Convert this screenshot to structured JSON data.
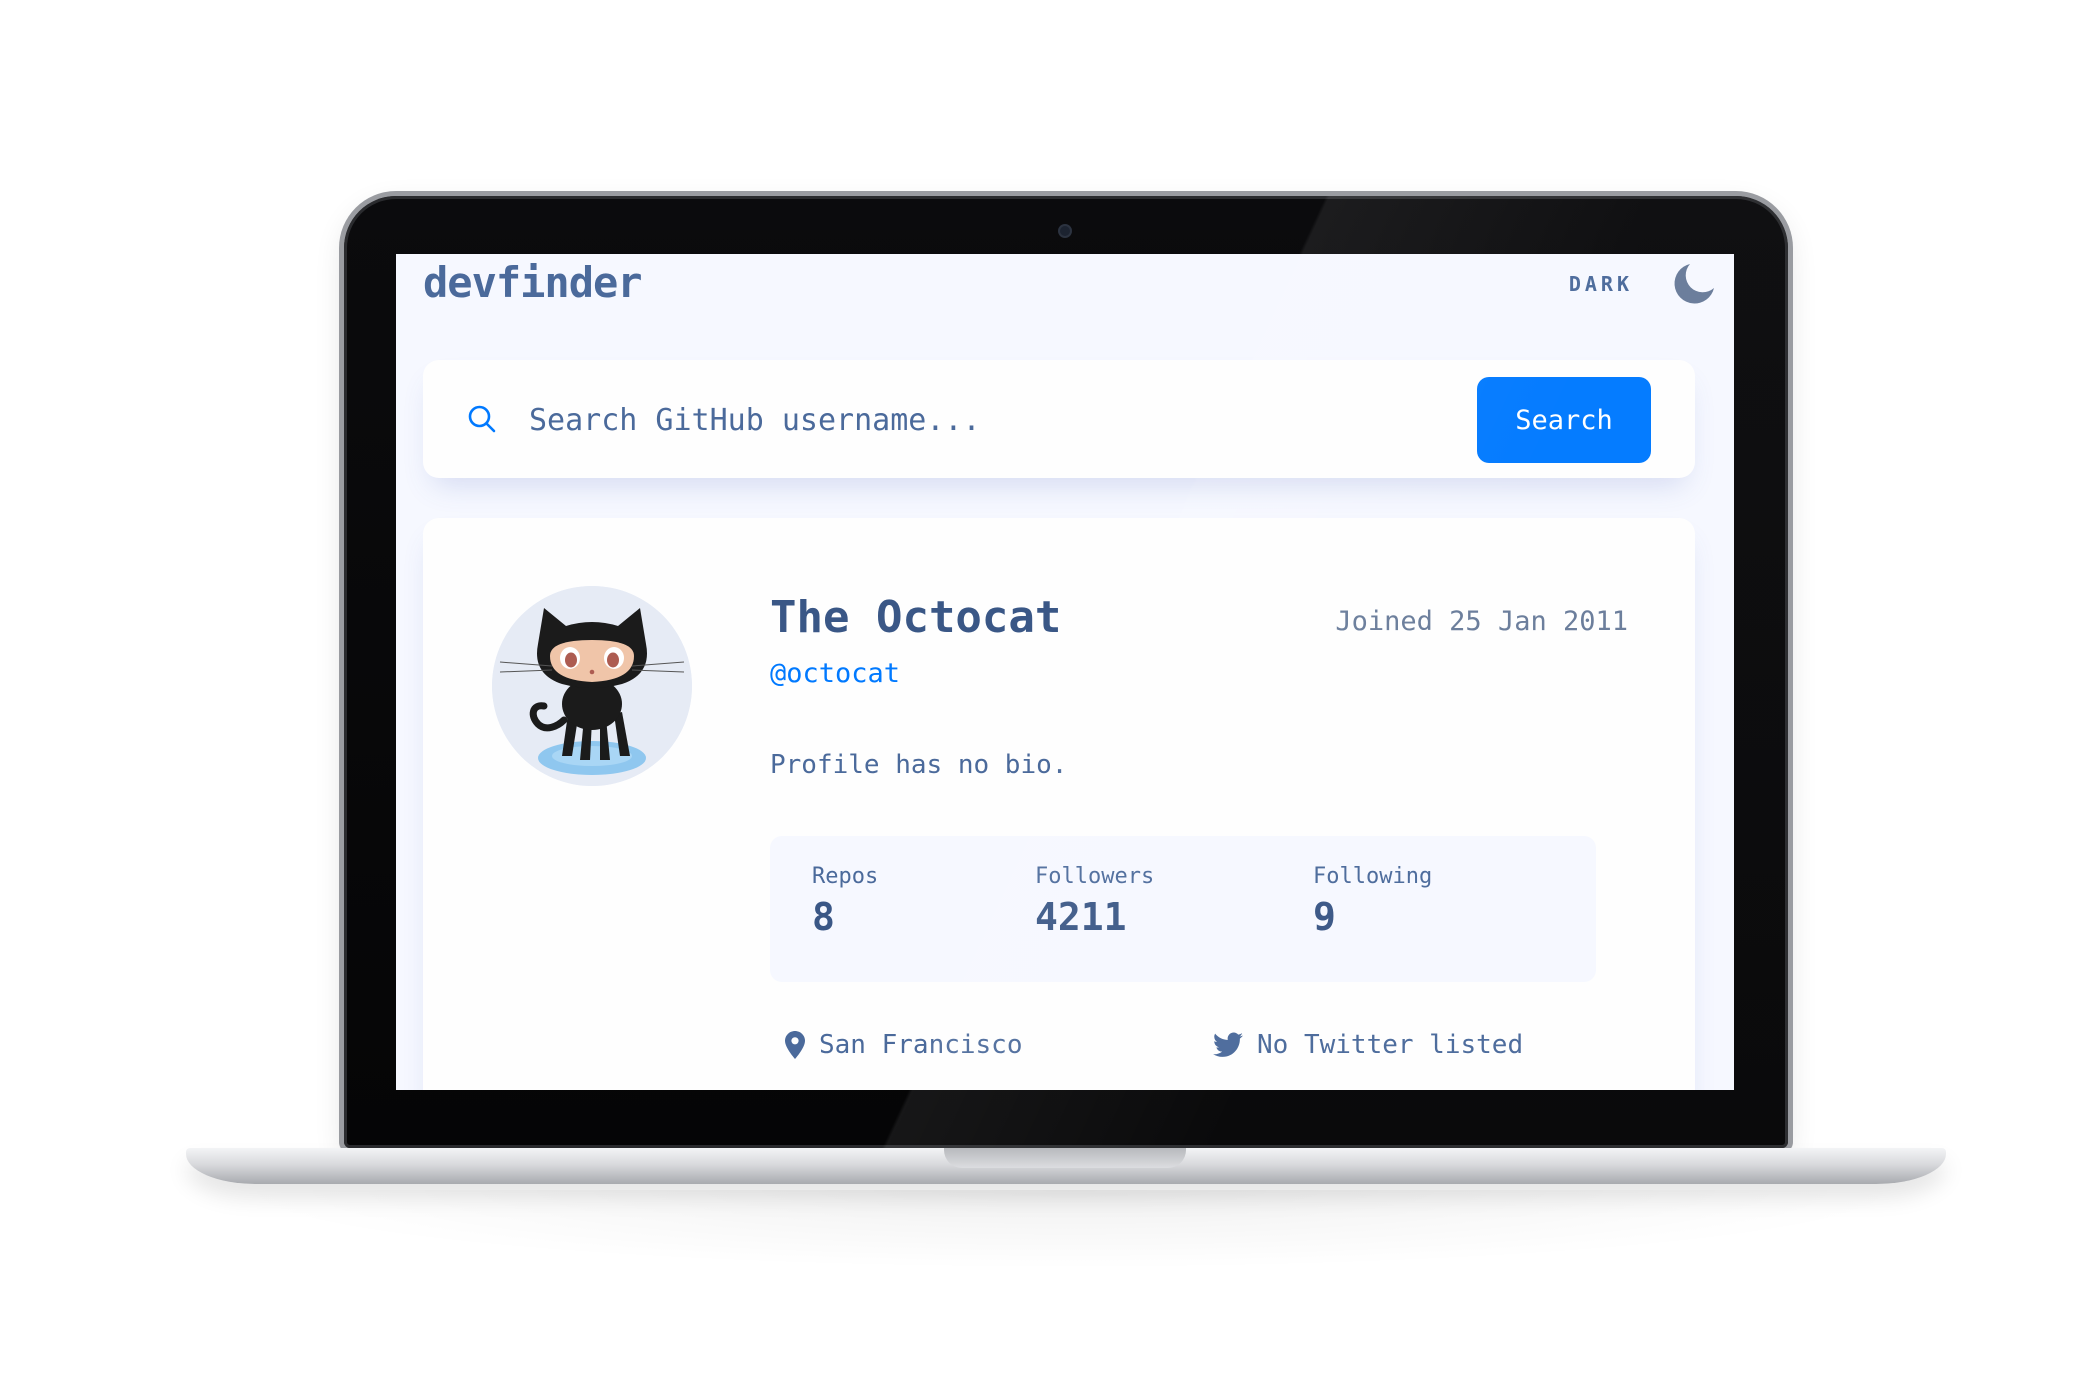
{
  "app": {
    "logo": "devfinder",
    "theme_toggle_label": "DARK",
    "theme_icon": "moon-icon"
  },
  "search": {
    "placeholder": "Search GitHub username...",
    "value": "",
    "button_label": "Search",
    "icon": "search-icon"
  },
  "profile": {
    "avatar_alt": "octocat-avatar",
    "name": "The Octocat",
    "login": "@octocat",
    "joined": "Joined 25 Jan 2011",
    "bio": "Profile has no bio.",
    "stats": [
      {
        "label": "Repos",
        "value": "8"
      },
      {
        "label": "Followers",
        "value": "4211"
      },
      {
        "label": "Following",
        "value": "9"
      }
    ],
    "links": [
      {
        "icon": "location-pin-icon",
        "text": "San Francisco"
      },
      {
        "icon": "twitter-icon",
        "text": "No Twitter listed"
      }
    ]
  },
  "colors": {
    "accent": "#0079ff",
    "text_primary": "#4b6a9b",
    "heading": "#3a5786",
    "background": "#f6f8ff",
    "card": "#fefefe"
  }
}
